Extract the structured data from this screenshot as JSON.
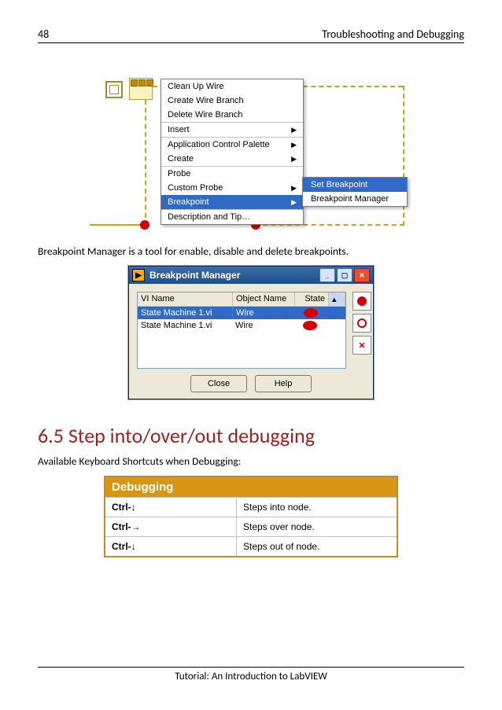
{
  "header": {
    "page_number": "48",
    "chapter_title": "Troubleshooting and Debugging"
  },
  "footer": {
    "text": "Tutorial: An Introduction to LabVIEW"
  },
  "context_menu": {
    "items": [
      "Clean Up Wire",
      "Create Wire Branch",
      "Delete Wire Branch",
      "Insert",
      "Application Control Palette",
      "Create",
      "Probe",
      "Custom Probe",
      "Breakpoint",
      "Description and Tip…"
    ],
    "sub_items": [
      "Set Breakpoint",
      "Breakpoint Manager"
    ]
  },
  "paragraph1": "Breakpoint Manager is a tool for enable, disable and delete breakpoints.",
  "bm_window": {
    "title": "Breakpoint Manager",
    "columns": [
      "VI Name",
      "Object Name",
      "State"
    ],
    "rows": [
      {
        "vi": "State Machine 1.vi",
        "obj": "Wire",
        "selected": true
      },
      {
        "vi": "State Machine 1.vi",
        "obj": "Wire",
        "selected": false
      }
    ],
    "close_btn": "Close",
    "help_btn": "Help"
  },
  "section": {
    "number": "6.5",
    "title": "Step into/over/out debugging"
  },
  "paragraph2": "Available Keyboard Shortcuts when Debugging:",
  "shortcuts": {
    "header": "Debugging",
    "rows": [
      {
        "key": "Ctrl-↓",
        "desc": "Steps into node."
      },
      {
        "key": "Ctrl-→",
        "desc": "Steps over node."
      },
      {
        "key": "Ctrl-↓",
        "desc": "Steps out of node."
      }
    ]
  }
}
